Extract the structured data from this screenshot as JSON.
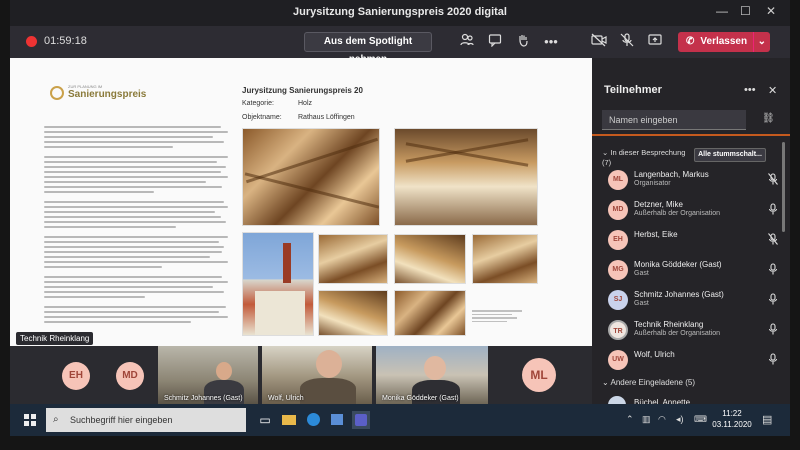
{
  "window": {
    "title": "Jurysitzung Sanierungspreis 2020 digital",
    "controls": [
      "—",
      "☐",
      "✕"
    ]
  },
  "toolbar": {
    "timer": "01:59:18",
    "spotlight_label": "Aus dem Spotlight nehmen",
    "leave_label": "Verlassen"
  },
  "document": {
    "logo_small": "ZUR PLANUNG IM",
    "logo_big": "Sanierungspreis",
    "title": "Jurysitzung Sanierungspreis 20",
    "category_label": "Kategorie:",
    "category_value": "Holz",
    "object_label": "Objektname:",
    "object_value": "Rathaus Löffingen"
  },
  "share_label": "Technik Rheinklang",
  "video": {
    "avatars": [
      "EH",
      "MD",
      "ML"
    ],
    "tiles": [
      "Schmitz Johannes (Gast)",
      "Wolf, Ulrich",
      "Monika Göddeker (Gast)"
    ]
  },
  "panel": {
    "title": "Teilnehmer",
    "search_placeholder": "Namen eingeben",
    "section": "In dieser Besprechung",
    "section_count": "(7)",
    "mute_all_label": "Alle stummschalt...",
    "participants": [
      {
        "initials": "ML",
        "name": "Langenbach, Markus",
        "role": "Organisator",
        "color": "#f6c4b8",
        "mic": "mic-off"
      },
      {
        "initials": "MD",
        "name": "Detzner, Mike",
        "role": "Außerhalb der Organisation",
        "color": "#f6c4b8",
        "mic": "mic"
      },
      {
        "initials": "EH",
        "name": "Herbst, Eike",
        "role": "",
        "color": "#f6c4b8",
        "mic": "mic-off"
      },
      {
        "initials": "MG",
        "name": "Monika Göddeker (Gast)",
        "role": "Gast",
        "color": "#f6c4b8",
        "mic": "mic"
      },
      {
        "initials": "SJ",
        "name": "Schmitz Johannes (Gast)",
        "role": "Gast",
        "color": "#c9d2ec",
        "mic": "mic"
      },
      {
        "initials": "TR",
        "name": "Technik Rheinklang",
        "role": "Außerhalb der Organisation",
        "color": "#f0e6e0",
        "mic": "mic"
      },
      {
        "initials": "UW",
        "name": "Wolf, Ulrich",
        "role": "",
        "color": "#f6c4b8",
        "mic": "mic"
      }
    ],
    "other_invited": "Andere Eingeladene (5)",
    "other_first": "Büchel, Annette"
  },
  "taskbar": {
    "search_placeholder": "Suchbegriff hier eingeben",
    "time": "11:22",
    "date": "03.11.2020"
  },
  "colors": {
    "leave": "#c4314b",
    "accent_line": "#c55a1e"
  }
}
